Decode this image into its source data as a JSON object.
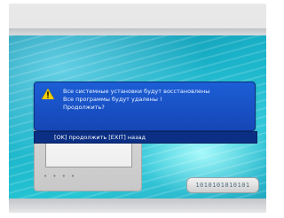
{
  "dialog": {
    "icon": "warning-icon",
    "line1": "Все системные установки будут восстановлены",
    "line2": "Все программы будут удалены !",
    "line3": "Продолжить?",
    "hint": "[OK] продолжить   [EXIT] назад"
  },
  "background": {
    "binary_label": "1010101010101",
    "controls_label": "• • • •"
  },
  "colors": {
    "dialog_blue": "#1c5ed6",
    "footer_blue": "#0a2f84",
    "warning_yellow": "#f5d000"
  }
}
